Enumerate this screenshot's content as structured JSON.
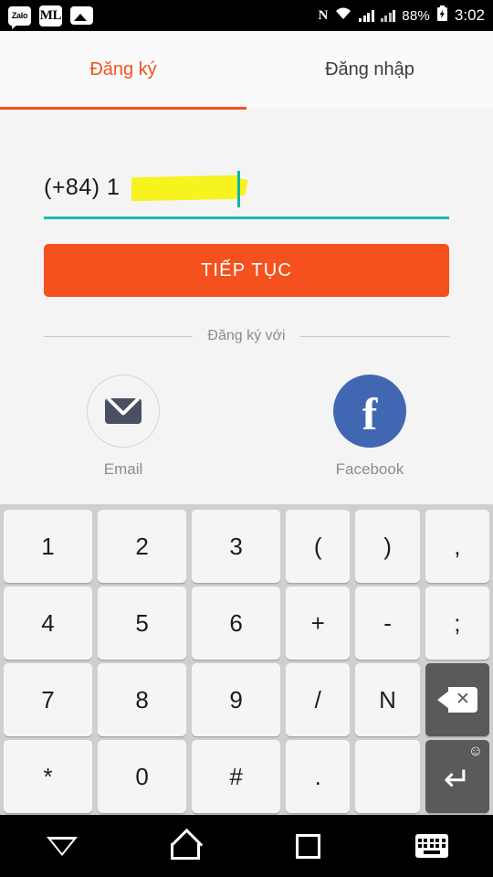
{
  "status_bar": {
    "left_icons": [
      {
        "name": "zalo-app-icon",
        "label": "Zalo"
      },
      {
        "name": "ml-app-icon",
        "label": "ML"
      },
      {
        "name": "gallery-app-icon",
        "label": ""
      }
    ],
    "nfc_icon": "N",
    "wifi_icon": "wifi",
    "signal_icon_1": "signal",
    "signal_icon_2": "signal",
    "battery_percent": "88%",
    "battery_icon": "charging-battery",
    "time": "3:02"
  },
  "tabs": [
    {
      "id": "register",
      "label": "Đăng ký",
      "active": true
    },
    {
      "id": "login",
      "label": "Đăng nhập",
      "active": false
    }
  ],
  "form": {
    "phone_prefix": "(+84) 1",
    "phone_redacted": true,
    "continue_label": "TIẾP TỤC",
    "divider_label": "Đăng ký với"
  },
  "socials": [
    {
      "id": "email",
      "label": "Email",
      "icon": "envelope-icon"
    },
    {
      "id": "facebook",
      "label": "Facebook",
      "icon": "facebook-f-icon"
    }
  ],
  "keyboard": {
    "rows": [
      [
        {
          "label": "1",
          "type": "wide"
        },
        {
          "label": "2",
          "type": "wide"
        },
        {
          "label": "3",
          "type": "wide"
        },
        {
          "label": "(",
          "type": "narrow"
        },
        {
          "label": ")",
          "type": "narrow"
        },
        {
          "label": ",",
          "type": "narrow"
        }
      ],
      [
        {
          "label": "4",
          "type": "wide"
        },
        {
          "label": "5",
          "type": "wide"
        },
        {
          "label": "6",
          "type": "wide"
        },
        {
          "label": "+",
          "type": "narrow"
        },
        {
          "label": "-",
          "type": "narrow"
        },
        {
          "label": ";",
          "type": "narrow"
        }
      ],
      [
        {
          "label": "7",
          "type": "wide"
        },
        {
          "label": "8",
          "type": "wide"
        },
        {
          "label": "9",
          "type": "wide"
        },
        {
          "label": "/",
          "type": "narrow"
        },
        {
          "label": "N",
          "type": "narrow"
        },
        {
          "label": "",
          "type": "backspace"
        }
      ],
      [
        {
          "label": "*",
          "type": "wide"
        },
        {
          "label": "0",
          "type": "wide"
        },
        {
          "label": "#",
          "type": "wide"
        },
        {
          "label": ".",
          "type": "narrow"
        },
        {
          "label": "",
          "type": "narrow"
        },
        {
          "label": "",
          "type": "enter"
        }
      ]
    ],
    "backspace_name": "backspace-key",
    "enter_name": "enter-key",
    "emoji_badge": "☺"
  },
  "nav_bar": [
    {
      "id": "back",
      "name": "nav-back-button"
    },
    {
      "id": "home",
      "name": "nav-home-button"
    },
    {
      "id": "recents",
      "name": "nav-recents-button"
    },
    {
      "id": "keyboard",
      "name": "nav-keyboard-button"
    }
  ],
  "colors": {
    "accent_orange": "#f4511e",
    "input_teal": "#17bdb0",
    "facebook_blue": "#4267b2",
    "highlight_yellow": "#f7f31f",
    "page_bg": "#f4f4f4",
    "keyboard_bg": "#cfcfcf"
  }
}
